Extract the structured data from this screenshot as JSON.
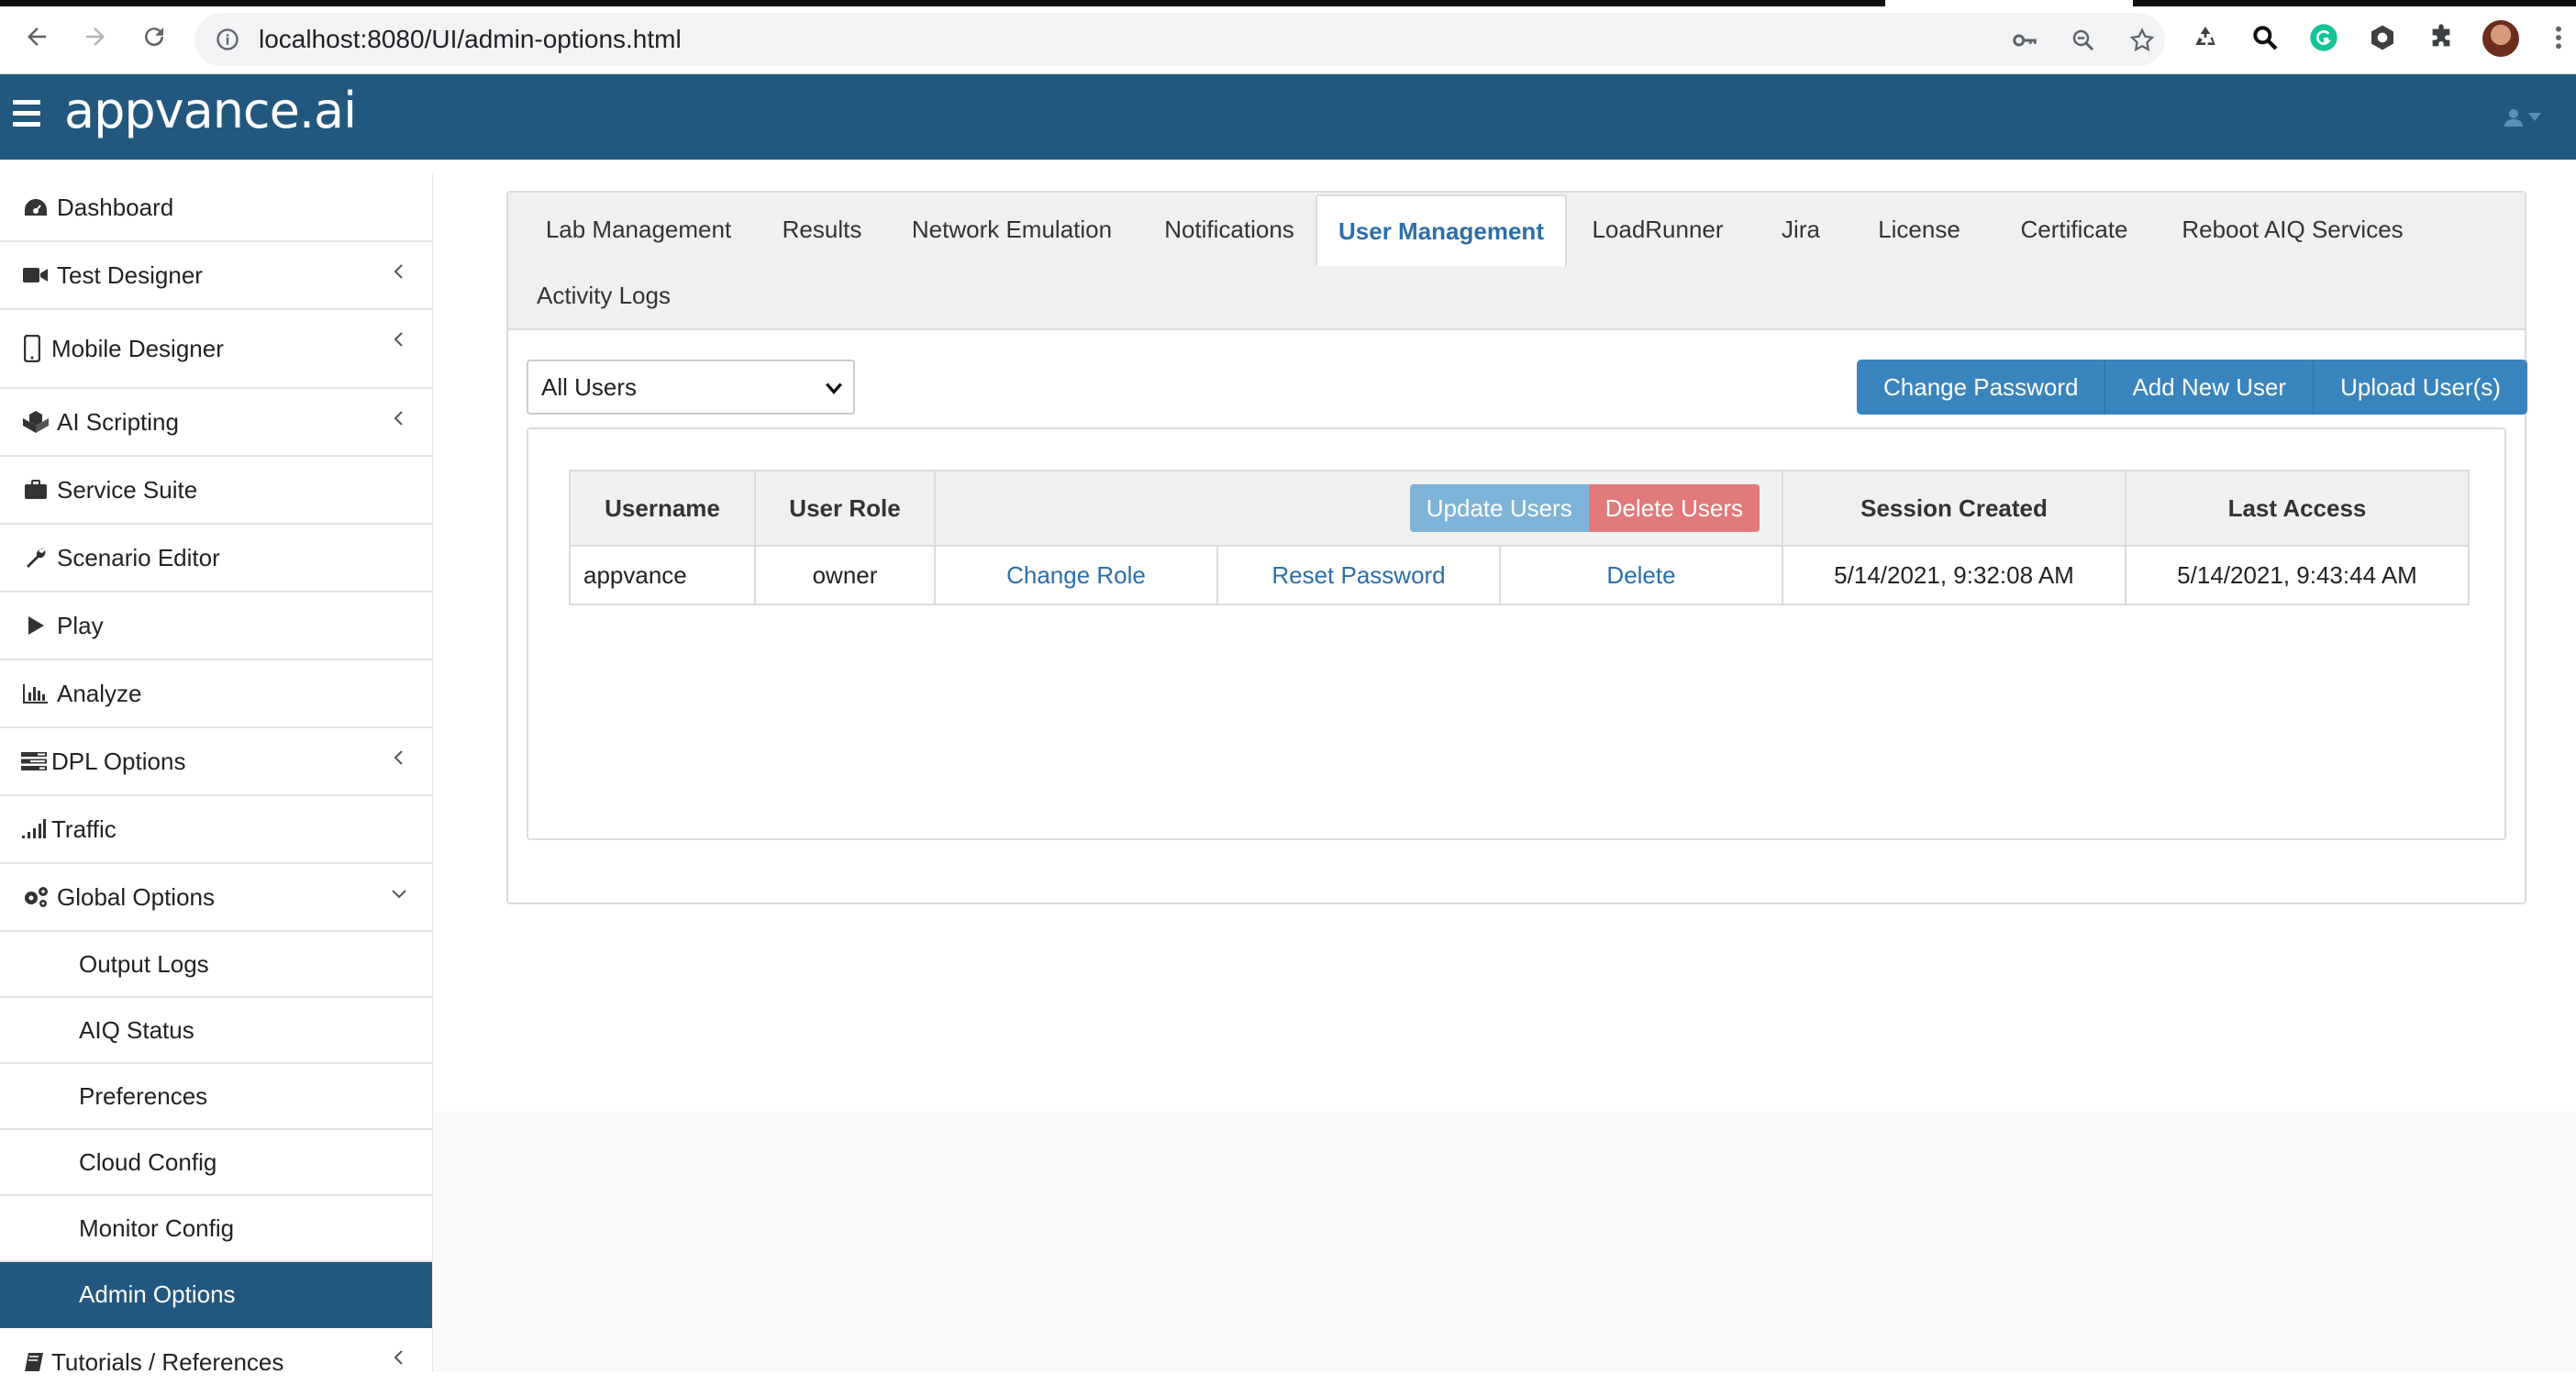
{
  "browser": {
    "url": "localhost:8080/UI/admin-options.html"
  },
  "app": {
    "logo": "appvance.ai"
  },
  "sidebar": {
    "items": [
      {
        "label": "Dashboard",
        "icon": "dashboard-icon"
      },
      {
        "label": "Test Designer",
        "icon": "video-camera-icon"
      },
      {
        "label": "Mobile Designer",
        "icon": "mobile-phone-icon"
      },
      {
        "label": "AI Scripting",
        "icon": "cubes-icon"
      },
      {
        "label": "Service Suite",
        "icon": "briefcase-icon"
      },
      {
        "label": "Scenario Editor",
        "icon": "wrench-icon"
      },
      {
        "label": "Play",
        "icon": "play-icon"
      },
      {
        "label": "Analyze",
        "icon": "bar-chart-icon"
      },
      {
        "label": "DPL Options",
        "icon": "tasks-icon"
      },
      {
        "label": "Traffic",
        "icon": "signal-icon"
      },
      {
        "label": "Global Options",
        "icon": "gears-icon"
      }
    ],
    "sub_items": [
      {
        "label": "Output Logs"
      },
      {
        "label": "AIQ Status"
      },
      {
        "label": "Preferences"
      },
      {
        "label": "Cloud Config"
      },
      {
        "label": "Monitor Config"
      },
      {
        "label": "Admin Options"
      }
    ],
    "footer_item": {
      "label": "Tutorials / References",
      "icon": "book-icon"
    }
  },
  "tabs": [
    {
      "label": "Lab Management"
    },
    {
      "label": "Results"
    },
    {
      "label": "Network Emulation"
    },
    {
      "label": "Notifications"
    },
    {
      "label": "User Management"
    },
    {
      "label": "LoadRunner"
    },
    {
      "label": "Jira"
    },
    {
      "label": "License"
    },
    {
      "label": "Certificate"
    },
    {
      "label": "Reboot AIQ Services"
    },
    {
      "label": "Activity Logs"
    }
  ],
  "filter": {
    "selected": "All Users"
  },
  "actions": {
    "change_password": "Change Password",
    "add_new_user": "Add New User",
    "upload_users": "Upload User(s)"
  },
  "table": {
    "headers": {
      "username": "Username",
      "user_role": "User Role",
      "session_created": "Session Created",
      "last_access": "Last Access"
    },
    "header_buttons": {
      "update": "Update Users",
      "delete": "Delete Users"
    },
    "rows": [
      {
        "username": "appvance",
        "role": "owner",
        "change_role": "Change Role",
        "reset_password": "Reset Password",
        "delete": "Delete",
        "session_created": "5/14/2021, 9:32:08 AM",
        "last_access": "5/14/2021, 9:43:44 AM"
      }
    ]
  },
  "colors": {
    "brand": "#22587d",
    "primary_button": "#3a84bd",
    "danger_button": "#e07a7a",
    "link": "#2d6ea8"
  }
}
